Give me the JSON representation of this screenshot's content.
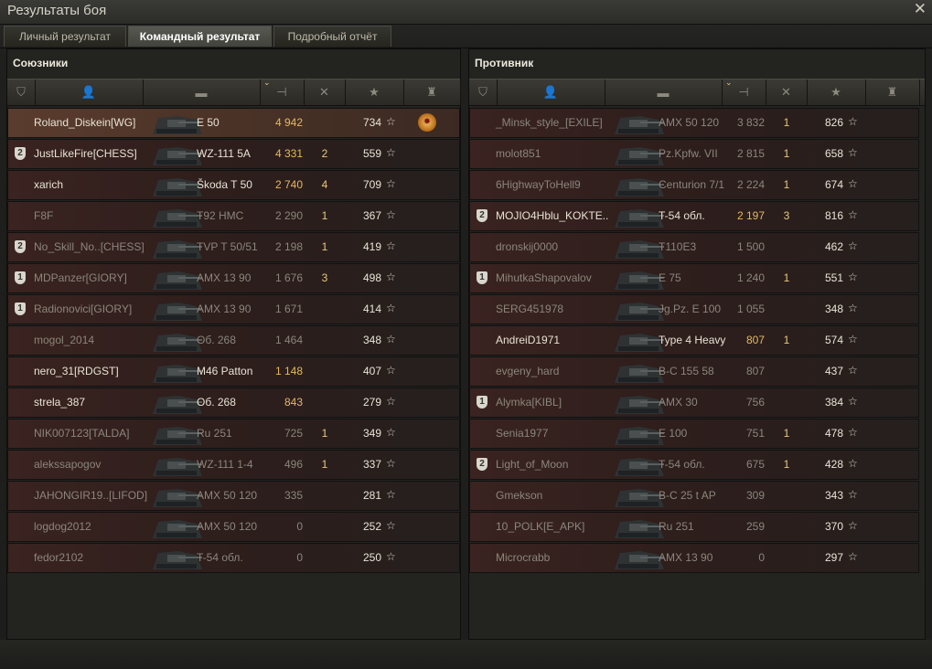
{
  "window": {
    "title": "Результаты боя",
    "close_icon": "close-icon"
  },
  "tabs": [
    {
      "label": "Личный результат",
      "active": false
    },
    {
      "label": "Командный результат",
      "active": true
    },
    {
      "label": "Подробный отчёт",
      "active": false
    }
  ],
  "colors": {
    "accent_gold": "#e6b760",
    "row_bg": "#2e1e1c",
    "header_bg": "#3b3a34"
  },
  "header_icons": [
    "platoon-icon",
    "player-icon",
    "tank-icon",
    "damage-icon",
    "kills-icon",
    "experience-star-icon",
    "medal-icon"
  ],
  "allies": {
    "title": "Союзники",
    "rows": [
      {
        "platoon": "",
        "name": "Roland_Diskein[WG]",
        "vehicle": "E 50",
        "damage": "4 942",
        "kills": "",
        "xp": "734",
        "medal": true,
        "alive": true
      },
      {
        "platoon": "2",
        "name": "JustLikeFire[CHESS]",
        "vehicle": "WZ-111 5A",
        "damage": "4 331",
        "kills": "2",
        "xp": "559",
        "medal": false,
        "alive": true
      },
      {
        "platoon": "",
        "name": "xarich",
        "vehicle": "Škoda T 50",
        "damage": "2 740",
        "kills": "4",
        "xp": "709",
        "medal": false,
        "alive": true
      },
      {
        "platoon": "",
        "name": "F8F",
        "vehicle": "T92 HMC",
        "damage": "2 290",
        "kills": "1",
        "xp": "367",
        "medal": false,
        "alive": false
      },
      {
        "platoon": "2",
        "name": "No_Skill_No..[CHESS]",
        "vehicle": "TVP T 50/51",
        "damage": "2 198",
        "kills": "1",
        "xp": "419",
        "medal": false,
        "alive": false
      },
      {
        "platoon": "1",
        "name": "MDPanzer[GIORY]",
        "vehicle": "AMX 13 90",
        "damage": "1 676",
        "kills": "3",
        "xp": "498",
        "medal": false,
        "alive": false
      },
      {
        "platoon": "1",
        "name": "Radionovici[GIORY]",
        "vehicle": "AMX 13 90",
        "damage": "1 671",
        "kills": "",
        "xp": "414",
        "medal": false,
        "alive": false
      },
      {
        "platoon": "",
        "name": "mogol_2014",
        "vehicle": "Об. 268",
        "damage": "1 464",
        "kills": "",
        "xp": "348",
        "medal": false,
        "alive": false
      },
      {
        "platoon": "",
        "name": "nero_31[RDGST]",
        "vehicle": "M46 Patton",
        "damage": "1 148",
        "kills": "",
        "xp": "407",
        "medal": false,
        "alive": true
      },
      {
        "platoon": "",
        "name": "strela_387",
        "vehicle": "Об. 268",
        "damage": "843",
        "kills": "",
        "xp": "279",
        "medal": false,
        "alive": true
      },
      {
        "platoon": "",
        "name": "NIK007123[TALDA]",
        "vehicle": "Ru 251",
        "damage": "725",
        "kills": "1",
        "xp": "349",
        "medal": false,
        "alive": false
      },
      {
        "platoon": "",
        "name": "alekssapogov",
        "vehicle": "WZ-111 1-4",
        "damage": "496",
        "kills": "1",
        "xp": "337",
        "medal": false,
        "alive": false
      },
      {
        "platoon": "",
        "name": "JAHONGIR19..[LIFOD]",
        "vehicle": "AMX 50 120",
        "damage": "335",
        "kills": "",
        "xp": "281",
        "medal": false,
        "alive": false
      },
      {
        "platoon": "",
        "name": "logdog2012",
        "vehicle": "AMX 50 120",
        "damage": "0",
        "kills": "",
        "xp": "252",
        "medal": false,
        "alive": false
      },
      {
        "platoon": "",
        "name": "fedor2102",
        "vehicle": "T-54 обл.",
        "damage": "0",
        "kills": "",
        "xp": "250",
        "medal": false,
        "alive": false
      }
    ]
  },
  "enemies": {
    "title": "Противник",
    "rows": [
      {
        "platoon": "",
        "name": "_Minsk_style_[EXILE]",
        "vehicle": "AMX 50 120",
        "damage": "3 832",
        "kills": "1",
        "xp": "826",
        "medal": false,
        "alive": false
      },
      {
        "platoon": "",
        "name": "molot851",
        "vehicle": "Pz.Kpfw. VII",
        "damage": "2 815",
        "kills": "1",
        "xp": "658",
        "medal": false,
        "alive": false
      },
      {
        "platoon": "",
        "name": "6HighwayToHell9",
        "vehicle": "Centurion 7/1",
        "damage": "2 224",
        "kills": "1",
        "xp": "674",
        "medal": false,
        "alive": false
      },
      {
        "platoon": "2",
        "name": "MOJIO4Hblu_KOKTE..",
        "vehicle": "T-54 обл.",
        "damage": "2 197",
        "kills": "3",
        "xp": "816",
        "medal": false,
        "alive": true
      },
      {
        "platoon": "",
        "name": "dronskij0000",
        "vehicle": "T110E3",
        "damage": "1 500",
        "kills": "",
        "xp": "462",
        "medal": false,
        "alive": false
      },
      {
        "platoon": "1",
        "name": "MihutkaShapovalov",
        "vehicle": "E 75",
        "damage": "1 240",
        "kills": "1",
        "xp": "551",
        "medal": false,
        "alive": false
      },
      {
        "platoon": "",
        "name": "SERG451978",
        "vehicle": "Jg.Pz. E 100",
        "damage": "1 055",
        "kills": "",
        "xp": "348",
        "medal": false,
        "alive": false
      },
      {
        "platoon": "",
        "name": "AndreiD1971",
        "vehicle": "Type 4 Heavy",
        "damage": "807",
        "kills": "1",
        "xp": "574",
        "medal": false,
        "alive": true
      },
      {
        "platoon": "",
        "name": "evgeny_hard",
        "vehicle": "B-C 155 58",
        "damage": "807",
        "kills": "",
        "xp": "437",
        "medal": false,
        "alive": false
      },
      {
        "platoon": "1",
        "name": "Alymka[KIBL]",
        "vehicle": "AMX 30",
        "damage": "756",
        "kills": "",
        "xp": "384",
        "medal": false,
        "alive": false
      },
      {
        "platoon": "",
        "name": "Senia1977",
        "vehicle": "E 100",
        "damage": "751",
        "kills": "1",
        "xp": "478",
        "medal": false,
        "alive": false
      },
      {
        "platoon": "2",
        "name": "Light_of_Moon",
        "vehicle": "T-54 обл.",
        "damage": "675",
        "kills": "1",
        "xp": "428",
        "medal": false,
        "alive": false
      },
      {
        "platoon": "",
        "name": "Gmekson",
        "vehicle": "B-C 25 t AP",
        "damage": "309",
        "kills": "",
        "xp": "343",
        "medal": false,
        "alive": false
      },
      {
        "platoon": "",
        "name": "10_POLK[E_APK]",
        "vehicle": "Ru 251",
        "damage": "259",
        "kills": "",
        "xp": "370",
        "medal": false,
        "alive": false
      },
      {
        "platoon": "",
        "name": "Microcrabb",
        "vehicle": "AMX 13 90",
        "damage": "0",
        "kills": "",
        "xp": "297",
        "medal": false,
        "alive": false
      }
    ]
  }
}
